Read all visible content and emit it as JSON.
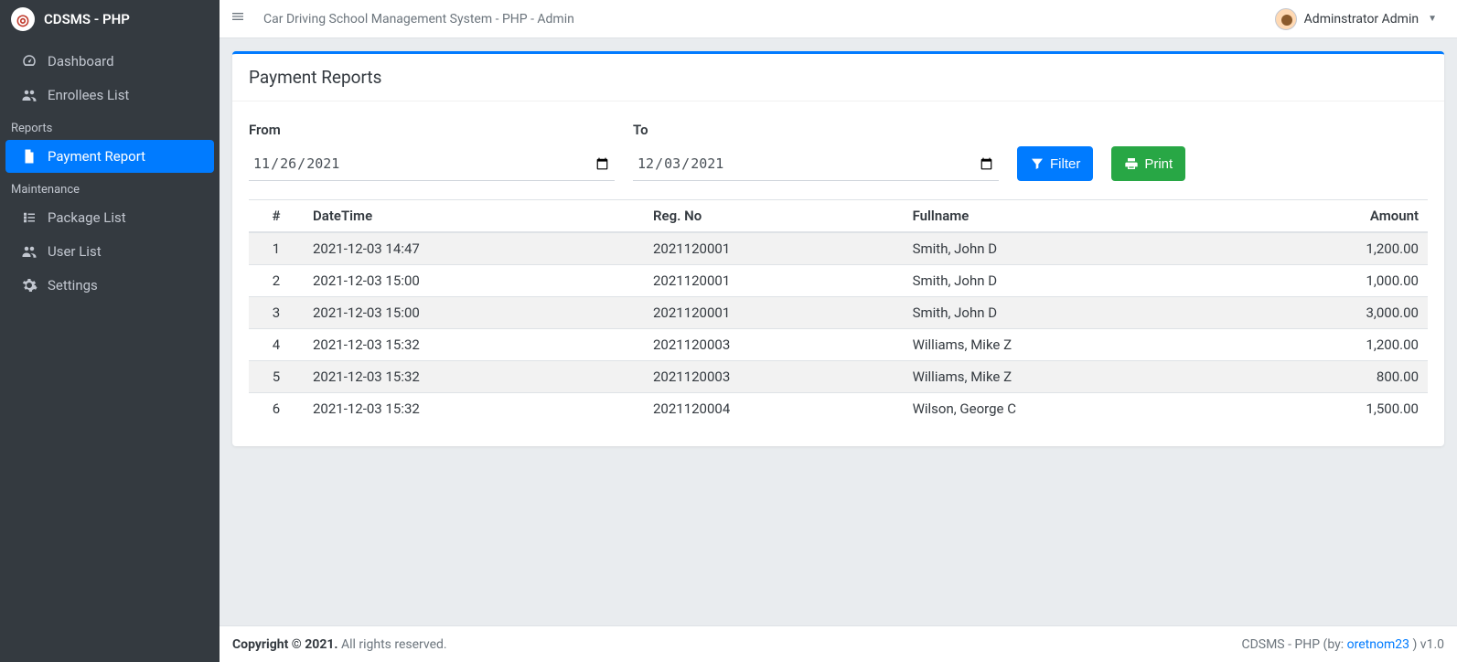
{
  "brand": {
    "name": "CDSMS - PHP"
  },
  "topbar": {
    "title": "Car Driving School Management System - PHP - Admin",
    "user_name": "Adminstrator Admin"
  },
  "sidebar": {
    "items_top": [
      {
        "label": "Dashboard",
        "active": false
      },
      {
        "label": "Enrollees List",
        "active": false
      }
    ],
    "section_reports": "Reports",
    "items_reports": [
      {
        "label": "Payment Report",
        "active": true
      }
    ],
    "section_maintenance": "Maintenance",
    "items_maintenance": [
      {
        "label": "Package List",
        "active": false
      },
      {
        "label": "User List",
        "active": false
      },
      {
        "label": "Settings",
        "active": false
      }
    ]
  },
  "page": {
    "title": "Payment Reports",
    "from_label": "From",
    "to_label": "To",
    "from_value": "11/26/2021",
    "to_value": "12/03/2021",
    "filter_label": "Filter",
    "print_label": "Print"
  },
  "table": {
    "headers": {
      "num": "#",
      "datetime": "DateTime",
      "regno": "Reg. No",
      "fullname": "Fullname",
      "amount": "Amount"
    },
    "rows": [
      {
        "n": "1",
        "dt": "2021-12-03 14:47",
        "reg": "2021120001",
        "name": "Smith, John D",
        "amt": "1,200.00"
      },
      {
        "n": "2",
        "dt": "2021-12-03 15:00",
        "reg": "2021120001",
        "name": "Smith, John D",
        "amt": "1,000.00"
      },
      {
        "n": "3",
        "dt": "2021-12-03 15:00",
        "reg": "2021120001",
        "name": "Smith, John D",
        "amt": "3,000.00"
      },
      {
        "n": "4",
        "dt": "2021-12-03 15:32",
        "reg": "2021120003",
        "name": "Williams, Mike Z",
        "amt": "1,200.00"
      },
      {
        "n": "5",
        "dt": "2021-12-03 15:32",
        "reg": "2021120003",
        "name": "Williams, Mike Z",
        "amt": "800.00"
      },
      {
        "n": "6",
        "dt": "2021-12-03 15:32",
        "reg": "2021120004",
        "name": "Wilson, George C",
        "amt": "1,500.00"
      }
    ]
  },
  "footer": {
    "copyright_bold": "Copyright © 2021.",
    "copyright_rest": " All rights reserved.",
    "right_prefix": "CDSMS - PHP (by: ",
    "right_link": "oretnom23",
    "right_suffix": " ) v1.0"
  }
}
